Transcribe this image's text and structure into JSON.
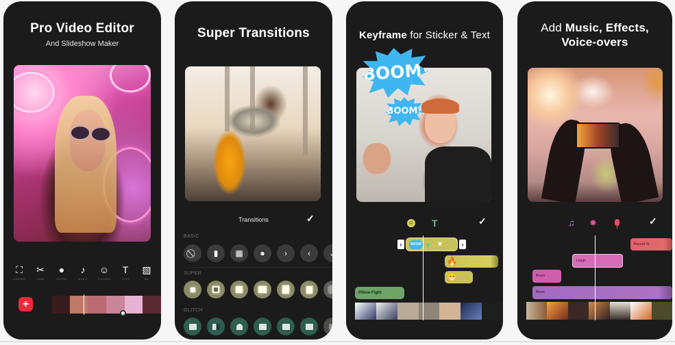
{
  "panels": [
    {
      "title": "Pro Video Editor",
      "subtitle": "And Slideshow Maker",
      "toolbar": [
        {
          "icon": "canvas-icon",
          "glyph": "⛶",
          "label": "CANVAS"
        },
        {
          "icon": "scissors-icon",
          "glyph": "✂",
          "label": "TRIM"
        },
        {
          "icon": "filter-icon",
          "glyph": "●",
          "label": "FILTER"
        },
        {
          "icon": "music-note-icon",
          "glyph": "♪",
          "label": "MUSIC"
        },
        {
          "icon": "sticker-icon",
          "glyph": "☺",
          "label": "STICKER"
        },
        {
          "icon": "text-icon",
          "glyph": "T",
          "label": "TEXT"
        },
        {
          "icon": "background-icon",
          "glyph": "▨",
          "label": "BG"
        }
      ],
      "add_button": "+"
    },
    {
      "title": "Super Transitions",
      "sheet_title": "Transitions",
      "confirm_glyph": "✓",
      "sections": {
        "basic": {
          "label": "BASIC",
          "items": [
            "⃠",
            "▮",
            "▦",
            "●",
            "›",
            "‹",
            "⌄"
          ]
        },
        "super": {
          "label": "SUPER"
        },
        "glitch": {
          "label": "GLITCH"
        }
      }
    },
    {
      "title_bold": "Keyframe",
      "title_rest": " for Sticker & Text",
      "stickers": [
        "BOOM!",
        "BOOM!"
      ],
      "icons": {
        "sticker": "☺",
        "text": "T",
        "confirm": "✓"
      },
      "keyframe_selection": {
        "left_handle": "‹",
        "right_handle": "›",
        "sticker_label": "BOOM",
        "keyframe_glyph": "▼"
      },
      "clips": [
        {
          "type": "emoji",
          "glyph": "🔥"
        },
        {
          "type": "emoji",
          "glyph": "😁"
        },
        {
          "type": "text",
          "label": "Pillow Fight"
        }
      ]
    },
    {
      "title_rest": "Add ",
      "title_bold_1": "Music, Effects,",
      "title_bold_2": "Voice-overs",
      "icons": {
        "music": "♫",
        "effects": "✸",
        "confirm": "✓"
      },
      "audio_clips": [
        {
          "label": "Record 01",
          "color": "#e45f6b"
        },
        {
          "label": "Laugh",
          "color": "#d86bb6"
        },
        {
          "label": "Boom",
          "color": "#cf5fae"
        },
        {
          "label": "Music",
          "color": "#a26bbf"
        }
      ]
    }
  ],
  "colors": {
    "panel_bg": "#1b1b1b",
    "add_button": "#ee2a3b",
    "super_transition": "#8b8a67",
    "glitch_transition": "#2f5d4f",
    "sticker_clip": "#c9c258",
    "text_clip": "#6da468"
  }
}
